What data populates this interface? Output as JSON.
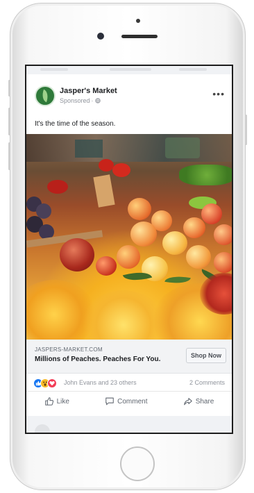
{
  "post": {
    "page_name": "Jasper's Market",
    "sponsored_label": "Sponsored",
    "privacy_icon": "globe-icon",
    "more_icon": "more-options-icon",
    "caption": "It's the time of the season."
  },
  "link": {
    "domain": "JASPERS-MARKET.COM",
    "headline": "Millions of Peaches. Peaches For You.",
    "cta_label": "Shop Now"
  },
  "engagement": {
    "reactions": [
      "like-icon",
      "wow-icon",
      "love-icon"
    ],
    "reacted_by": "John Evans and 23 others",
    "comments": "2 Comments"
  },
  "actions": {
    "like_label": "Like",
    "comment_label": "Comment",
    "share_label": "Share"
  },
  "colors": {
    "like": "#1877f2",
    "wow": "#f7b928",
    "love": "#f33e58",
    "brand_green": "#2f7a3a"
  }
}
